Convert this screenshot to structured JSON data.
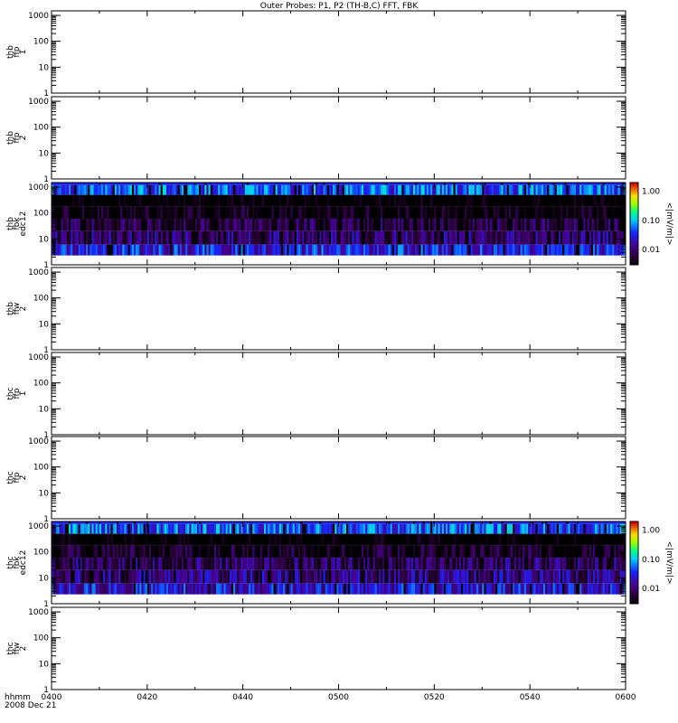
{
  "chart_data": {
    "type": "heatmap",
    "title": "Outer Probes: P1, P2 (TH-B,C) FFT, FBK",
    "x_ticks": [
      "0400",
      "0420",
      "0440",
      "0500",
      "0520",
      "0540",
      "0600"
    ],
    "x_label": [
      "hhmm",
      "2008 Dec 21"
    ],
    "y_ticks": [
      "1",
      "10",
      "100",
      "1000"
    ],
    "ylim": [
      1,
      1000
    ],
    "colorbar": {
      "label": "<|mV/m|>",
      "ticks": [
        "1.00",
        "0.10",
        "0.01"
      ],
      "range": [
        0.003,
        2
      ]
    },
    "panels": [
      {
        "label": [
          "thb",
          "ffp",
          "1"
        ],
        "spectrogram": false
      },
      {
        "label": [
          "thb",
          "ffp",
          "2"
        ],
        "spectrogram": false
      },
      {
        "label": [
          "thb",
          "fbk",
          "edc12"
        ],
        "spectrogram": true,
        "seed": 7,
        "band_levels": [
          0.05,
          0.002,
          0.003,
          0.006,
          0.01,
          0.03
        ]
      },
      {
        "label": [
          "thb",
          "ffw",
          "2"
        ],
        "spectrogram": false
      },
      {
        "label": [
          "thc",
          "ffp",
          "1"
        ],
        "spectrogram": false
      },
      {
        "label": [
          "thc",
          "ffp",
          "2"
        ],
        "spectrogram": false
      },
      {
        "label": [
          "thc",
          "fbk",
          "edc12"
        ],
        "spectrogram": true,
        "seed": 13,
        "band_levels": [
          0.05,
          0.002,
          0.004,
          0.008,
          0.012,
          0.025
        ]
      },
      {
        "label": [
          "thc",
          "ffw",
          "2"
        ],
        "spectrogram": false
      }
    ]
  }
}
